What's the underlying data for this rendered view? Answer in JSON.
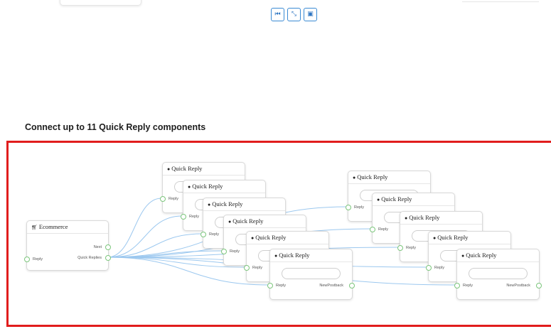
{
  "toolbar": {
    "buttons": [
      {
        "name": "first-page-button",
        "icon": "step-backward-icon",
        "glyph": "⏮"
      },
      {
        "name": "fit-view-button",
        "icon": "compress-icon",
        "glyph": "⤡"
      },
      {
        "name": "save-button",
        "icon": "save-icon",
        "glyph": "▣"
      }
    ]
  },
  "section": {
    "heading": "Connect up to 11 Quick Reply components"
  },
  "flow": {
    "root": {
      "title": "Ecommerce",
      "icon": "shopping-cart-icon",
      "input_label": "Reply",
      "outputs": [
        "Next",
        "Quick Replies"
      ]
    },
    "quick_reply_nodes": [
      {
        "title": "Quick Reply",
        "input_label": "Reply"
      },
      {
        "title": "Quick Reply",
        "input_label": "Reply"
      },
      {
        "title": "Quick Reply",
        "input_label": "Reply"
      },
      {
        "title": "Quick Reply",
        "input_label": "Reply"
      },
      {
        "title": "Quick Reply",
        "input_label": "Reply"
      },
      {
        "title": "Quick Reply",
        "input_label": "Reply",
        "output_label": "NewPostback"
      },
      {
        "title": "Quick Reply",
        "input_label": "Reply"
      },
      {
        "title": "Quick Reply",
        "input_label": "Reply"
      },
      {
        "title": "Quick Reply",
        "input_label": "Reply"
      },
      {
        "title": "Quick Reply",
        "input_label": "Reply"
      },
      {
        "title": "Quick Reply",
        "input_label": "Reply",
        "output_label": "NewPostback"
      }
    ],
    "qr_icon": "comment-icon",
    "colors": {
      "frame_border": "#e11d1d",
      "edge": "#9cc8ef",
      "port": "#7cc67c",
      "toolbar_accent": "#3a8ad4"
    }
  }
}
